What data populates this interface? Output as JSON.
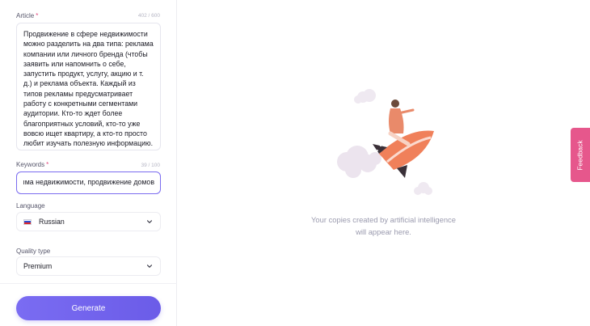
{
  "form": {
    "article": {
      "label": "Article",
      "required_mark": "*",
      "counter": "402 / 600",
      "value": "Продвижение в сфере недвижимости\nможно разделить на два типа: реклама\nкомпании или личного бренда (чтобы\nзаявить или напомнить о себе,\nзапустить продукт, услугу, акцию и т.\nд.) и реклама объекта. Каждый из\nтипов рекламы предусматривает\nработу с конкретными сегментами\nаудитории. Кто-то ждет более\nблагоприятных условий, кто-то уже\nвовсю ищет квартиру, а кто-то просто\nлюбит изучать полезную информацию."
    },
    "keywords": {
      "label": "Keywords",
      "required_mark": "*",
      "counter": "39 / 100",
      "value": "ıма недвижимости, продвижение домов"
    },
    "language": {
      "label": "Language",
      "selected": "Russian",
      "flag_icon": "russia-flag-icon"
    },
    "quality": {
      "label": "Quality type",
      "selected": "Premium"
    },
    "generate_label": "Generate"
  },
  "empty_state": {
    "line1": "Your copies created by artificial intelligence",
    "line2": "will appear here."
  },
  "feedback_label": "Feedback",
  "colors": {
    "accent": "#7a6cf2",
    "feedback": "#e6578c",
    "required": "#e0457b"
  }
}
